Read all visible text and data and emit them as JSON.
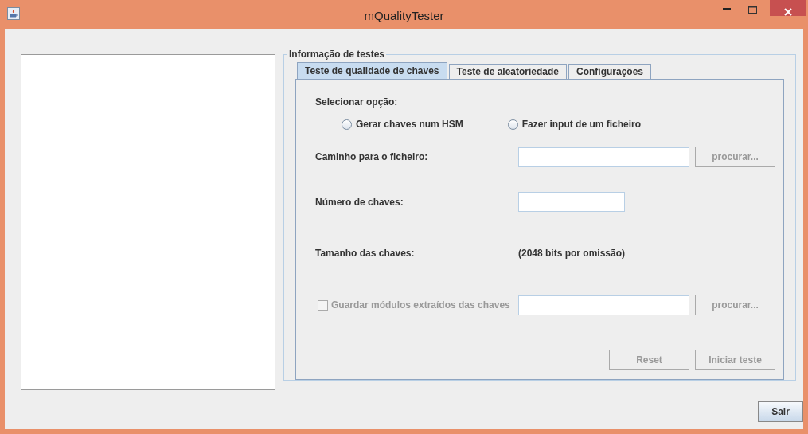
{
  "window": {
    "title": "mQualityTester"
  },
  "group": {
    "title": "Informação de testes"
  },
  "tabs": [
    {
      "label": "Teste de qualidade de chaves",
      "selected": true
    },
    {
      "label": "Teste de aleatoriedade",
      "selected": false
    },
    {
      "label": "Configurações",
      "selected": false
    }
  ],
  "form": {
    "select_label": "Selecionar opção:",
    "options": [
      {
        "label": "Gerar chaves num HSM",
        "selected": false
      },
      {
        "label": "Fazer input de um ficheiro",
        "selected": false
      }
    ],
    "path": {
      "label": "Caminho para o ficheiro:",
      "button": {
        "label": "procurar...",
        "disabled": true
      }
    },
    "count": {
      "label": "Número de chaves:"
    },
    "size": {
      "label": "Tamanho das chaves:",
      "value": "(2048 bits por omissão)"
    },
    "save": {
      "label": "Guardar módulos extraídos das chaves",
      "checked": false,
      "disabled": true,
      "button": {
        "label": "procurar...",
        "disabled": true
      }
    },
    "actions": [
      {
        "label": "Reset",
        "disabled": true
      },
      {
        "label": "Iniciar teste",
        "disabled": true
      }
    ]
  },
  "exit_button": {
    "label": "Sair",
    "disabled": false
  }
}
